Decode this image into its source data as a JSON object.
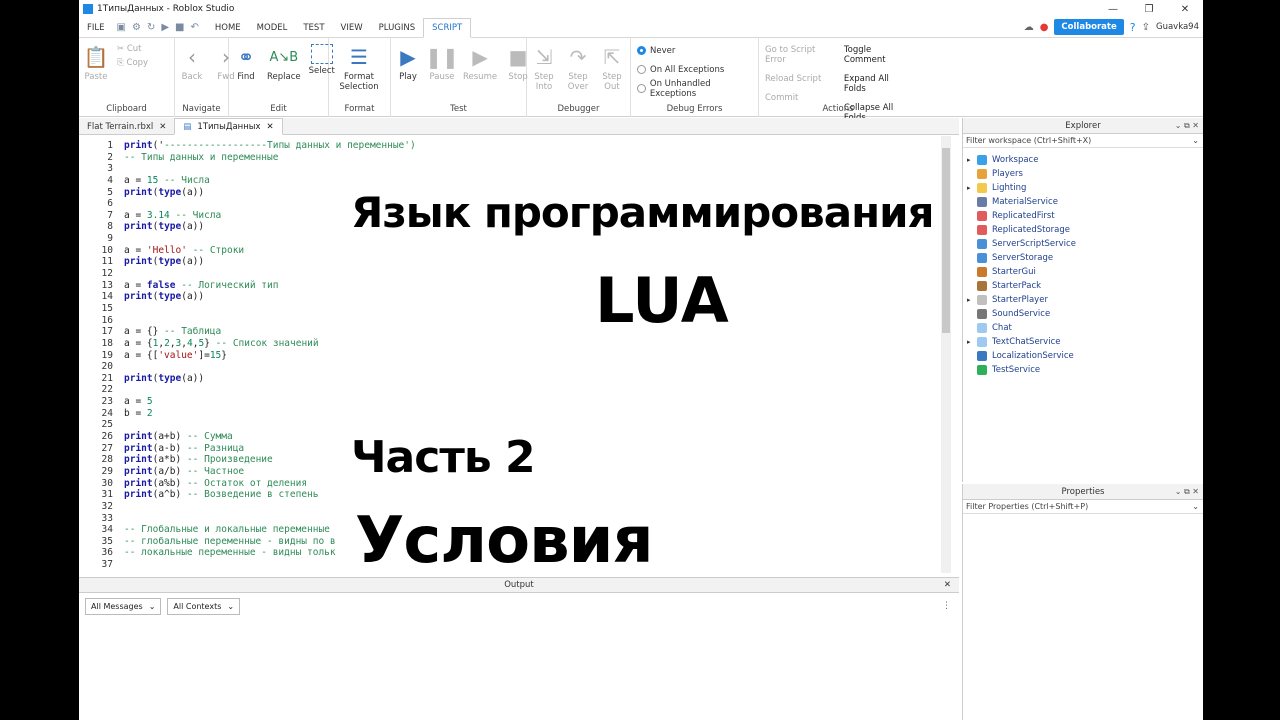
{
  "window": {
    "title": "1ТипыДанных - Roblox Studio",
    "controls": [
      "—",
      "❐",
      "✕"
    ]
  },
  "menu": {
    "items": [
      "FILE",
      "HOME",
      "MODEL",
      "TEST",
      "VIEW",
      "PLUGINS",
      "SCRIPT"
    ],
    "active": "SCRIPT",
    "collaborate": "Collaborate",
    "user": "Guavka94"
  },
  "ribbon": {
    "clipboard": {
      "label": "Clipboard",
      "paste": "Paste",
      "cut": "Cut",
      "copy": "Copy"
    },
    "navigate": {
      "label": "Navigate",
      "back": "Back",
      "fwd": "Fwd"
    },
    "edit": {
      "label": "Edit",
      "find": "Find",
      "replace": "Replace",
      "select": "Select"
    },
    "format": {
      "label": "Format",
      "format_selection_1": "Format",
      "format_selection_2": "Selection"
    },
    "test": {
      "label": "Test",
      "play": "Play",
      "pause": "Pause",
      "resume": "Resume",
      "stop": "Stop"
    },
    "debugger": {
      "label": "Debugger",
      "step_into_1": "Step",
      "step_into_2": "Into",
      "step_over_1": "Step",
      "step_over_2": "Over",
      "step_out_1": "Step",
      "step_out_2": "Out"
    },
    "debug_errors": {
      "label": "Debug Errors",
      "never": "Never",
      "all": "On All Exceptions",
      "unhandled": "On Unhandled Exceptions",
      "selected": "Never"
    },
    "actions": {
      "label": "Actions",
      "goto": "Go to Script Error",
      "reload": "Reload Script",
      "commit": "Commit",
      "toggle_comment": "Toggle Comment",
      "expand": "Expand All Folds",
      "collapse": "Collapse All Folds"
    }
  },
  "tabs": [
    {
      "label": "Flat Terrain.rbxl"
    },
    {
      "label": "1ТипыДанных"
    }
  ],
  "code_lines": [
    "print('------------------Типы данных и переменные')",
    "-- Типы данных и переменные",
    "",
    "a = 15 -- Числа",
    "print(type(a))",
    "",
    "a = 3.14 -- Числа",
    "print(type(a))",
    "",
    "a = 'Hello' -- Строки",
    "print(type(a))",
    "",
    "a = false -- Логический тип",
    "print(type(a))",
    "",
    "",
    "a = {} -- Таблица",
    "a = {1,2,3,4,5} -- Список значений",
    "a = {['value']=15}",
    "",
    "print(type(a))",
    "",
    "a = 5",
    "b = 2",
    "",
    "print(a+b) -- Сумма",
    "print(a-b) -- Разница",
    "print(a*b) -- Произведение",
    "print(a/b) -- Частное",
    "print(a%b) -- Остаток от деления",
    "print(a^b) -- Возведение в степень",
    "",
    "",
    "-- Глобальные и локальные переменные",
    "-- глобальные переменные - видны по в",
    "-- локальные переменные - видны тольк",
    ""
  ],
  "overlay": {
    "title": "Язык программирования",
    "lang": "LUA",
    "part": "Часть 2",
    "topic": "Условия"
  },
  "output": {
    "title": "Output",
    "messages": "All Messages",
    "contexts": "All Contexts"
  },
  "explorer": {
    "title": "Explorer",
    "filter": "Filter workspace (Ctrl+Shift+X)",
    "items": [
      {
        "label": "Workspace",
        "arrow": "▸",
        "color": "#3aa0e8"
      },
      {
        "label": "Players",
        "arrow": "",
        "color": "#e8a23a"
      },
      {
        "label": "Lighting",
        "arrow": "▸",
        "color": "#f2c94c"
      },
      {
        "label": "MaterialService",
        "arrow": "",
        "color": "#6b7ba8"
      },
      {
        "label": "ReplicatedFirst",
        "arrow": "",
        "color": "#e05b5b"
      },
      {
        "label": "ReplicatedStorage",
        "arrow": "",
        "color": "#e05b5b"
      },
      {
        "label": "ServerScriptService",
        "arrow": "",
        "color": "#4a90d9"
      },
      {
        "label": "ServerStorage",
        "arrow": "",
        "color": "#4a90d9"
      },
      {
        "label": "StarterGui",
        "arrow": "",
        "color": "#c97a2e"
      },
      {
        "label": "StarterPack",
        "arrow": "",
        "color": "#a8743a"
      },
      {
        "label": "StarterPlayer",
        "arrow": "▸",
        "color": "#c0c0c0"
      },
      {
        "label": "SoundService",
        "arrow": "",
        "color": "#777777"
      },
      {
        "label": "Chat",
        "arrow": "",
        "color": "#9ec9f0"
      },
      {
        "label": "TextChatService",
        "arrow": "▸",
        "color": "#9ec9f0"
      },
      {
        "label": "LocalizationService",
        "arrow": "",
        "color": "#3a78c0"
      },
      {
        "label": "TestService",
        "arrow": "",
        "color": "#2eb05a"
      }
    ]
  },
  "properties": {
    "title": "Properties",
    "filter": "Filter Properties (Ctrl+Shift+P)"
  }
}
